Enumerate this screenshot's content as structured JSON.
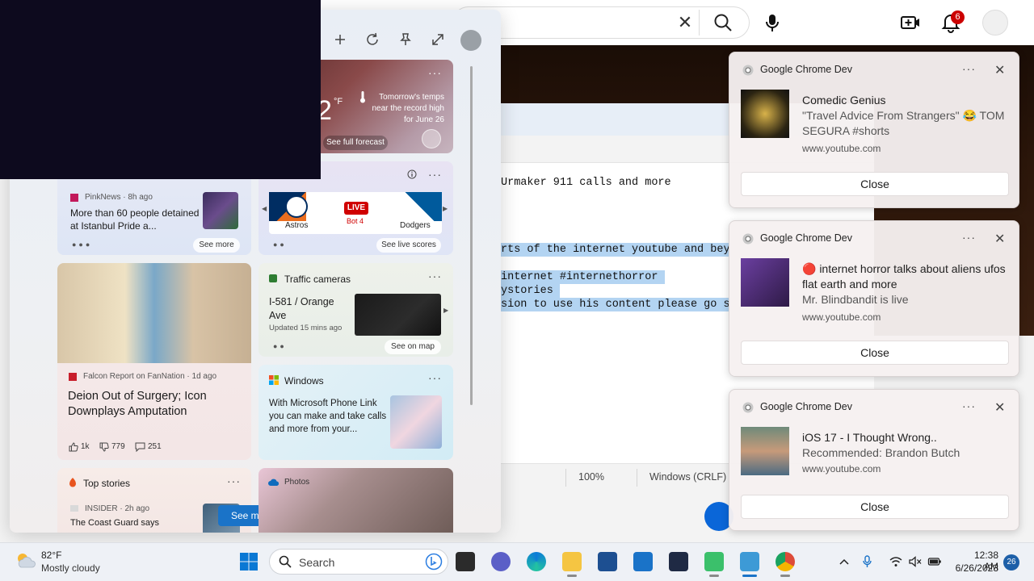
{
  "browser": {
    "notification_count": "6"
  },
  "notepad": {
    "lines": [
      {
        "text": "Urmaker 911 calls and more",
        "selected": false
      },
      {
        "text": "rts of the internet youtube and bey",
        "selected": true
      },
      {
        "text": "internet #internethorror ",
        "selected": true
      },
      {
        "text": "ystories ",
        "selected": true
      },
      {
        "text": "sion to use his content please go s",
        "selected": true
      }
    ],
    "status": {
      "zoom": "100%",
      "line_ending": "Windows (CRLF)"
    }
  },
  "widgets": {
    "weather": {
      "temp_fragment": "2",
      "unit": "°F",
      "alert_line1": "Tomorrow's temps",
      "alert_line2": "near the record high",
      "alert_line3": "for June 26",
      "forecast_button": "See full forecast"
    },
    "pinknews": {
      "source": "PinkNews · 8h ago",
      "headline": "More than 60 people detained at Istanbul Pride a...",
      "see_more": "See more"
    },
    "sports": {
      "team1": "Astros",
      "team2": "Dodgers",
      "live": "LIVE",
      "inning": "Bot 4",
      "see_live_scores": "See live scores"
    },
    "falcon": {
      "source": "Falcon Report on FanNation · 1d ago",
      "headline": "Deion Out of Surgery; Icon Downplays Amputation",
      "likes": "1k",
      "dislikes": "779",
      "comments": "251"
    },
    "traffic": {
      "title": "Traffic cameras",
      "location": "I-581 / Orange Ave",
      "updated": "Updated 15 mins ago",
      "see_on_map": "See on map"
    },
    "windows": {
      "title": "Windows",
      "body": "With Microsoft Phone Link you can make and take calls and more from your..."
    },
    "top_stories": {
      "title": "Top stories",
      "source": "INSIDER · 2h ago",
      "headline": "The Coast Guard says",
      "see_more": "See more"
    },
    "photos": {
      "title": "Photos"
    }
  },
  "notifications": [
    {
      "app": "Google Chrome Dev",
      "line1": "Comedic Genius",
      "line2": "\"Travel Advice From Strangers\" 😂 TOM SEGURA #shorts",
      "url": "www.youtube.com",
      "close": "Close"
    },
    {
      "app": "Google Chrome Dev",
      "line1": "🔴 internet horror talks about aliens ufos flat earth and more",
      "line2": "Mr. Blindbandit is live",
      "url": "www.youtube.com",
      "close": "Close"
    },
    {
      "app": "Google Chrome Dev",
      "line1": "iOS 17 - I Thought Wrong..",
      "line2": "Recommended: Brandon Butch",
      "url": "www.youtube.com",
      "close": "Close"
    }
  ],
  "taskbar": {
    "weather_temp": "82°F",
    "weather_cond": "Mostly cloudy",
    "search_label": "Search",
    "time": "12:38 AM",
    "date": "6/26/2023",
    "notification_count": "26"
  }
}
